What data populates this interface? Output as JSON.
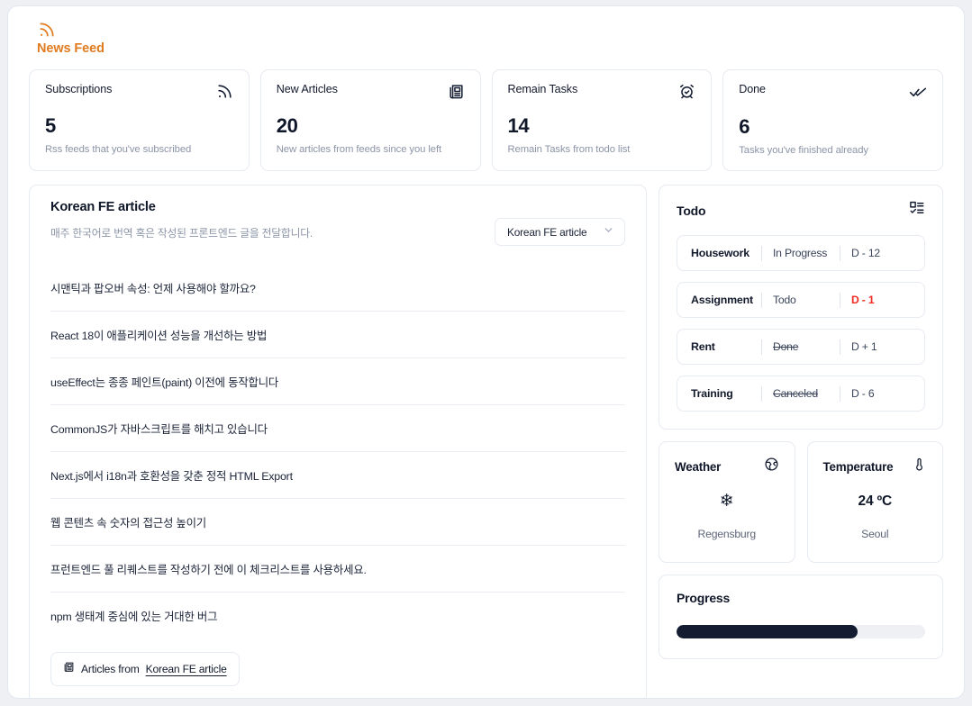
{
  "header": {
    "title": "News Feed",
    "icon": "rss-icon",
    "accent_color": "#e07b20"
  },
  "stats": [
    {
      "label": "Subscriptions",
      "value": "5",
      "description": "Rss feeds that you've subscribed",
      "icon": "rss-icon"
    },
    {
      "label": "New Articles",
      "value": "20",
      "description": "New articles from feeds since you left",
      "icon": "newspaper-icon"
    },
    {
      "label": "Remain Tasks",
      "value": "14",
      "description": "Remain Tasks from todo list",
      "icon": "alarm-clock-check-icon"
    },
    {
      "label": "Done",
      "value": "6",
      "description": "Tasks you've finished already",
      "icon": "double-check-icon"
    }
  ],
  "feed": {
    "title": "Korean FE article",
    "subtitle": "매주 한국어로 번역 혹은 작성된 프론트엔드 글을 전달합니다.",
    "select": {
      "value": "Korean FE article",
      "options": [
        "Korean FE article"
      ],
      "icon": "chevron-down-icon"
    },
    "articles": [
      "시맨틱과 팝오버 속성: 언제 사용해야 할까요?",
      "React 18이 애플리케이션 성능을 개선하는 방법",
      "useEffect는 종종 페인트(paint) 이전에 동작합니다",
      "CommonJS가 자바스크립트를 해치고 있습니다",
      "Next.js에서 i18n과 호환성을 갖춘 정적 HTML Export",
      "웹 콘텐츠 속 숫자의 접근성 높이기",
      "프런트엔드 풀 리퀘스트를 작성하기 전에 이 체크리스트를 사용하세요.",
      "npm 생태계 중심에 있는 거대한 버그"
    ],
    "footer": {
      "icon": "newspaper-icon",
      "text": "Articles from",
      "link": "Korean FE article"
    }
  },
  "todo": {
    "title": "Todo",
    "icon": "list-checks-icon",
    "items": [
      {
        "name": "Housework",
        "status": "In Progress",
        "due": "D - 12",
        "status_style": "normal",
        "due_style": "normal"
      },
      {
        "name": "Assignment",
        "status": "Todo",
        "due": "D - 1",
        "status_style": "normal",
        "due_style": "urgent"
      },
      {
        "name": "Rent",
        "status": "Done",
        "due": "D + 1",
        "status_style": "strike",
        "due_style": "normal"
      },
      {
        "name": "Training",
        "status": "Canceled",
        "due": "D - 6",
        "status_style": "strike",
        "due_style": "normal"
      }
    ],
    "urgent_color": "#ef2a22"
  },
  "weather": {
    "title": "Weather",
    "icon": "globe-icon",
    "condition_glyph": "❄",
    "condition_name": "snow-icon",
    "location": "Regensburg"
  },
  "temperature": {
    "title": "Temperature",
    "icon": "thermometer-icon",
    "value": "24 ºC",
    "location": "Seoul"
  },
  "progress": {
    "title": "Progress",
    "percent": 73,
    "fill_color": "#131c31",
    "track_color": "#eef0f4"
  }
}
